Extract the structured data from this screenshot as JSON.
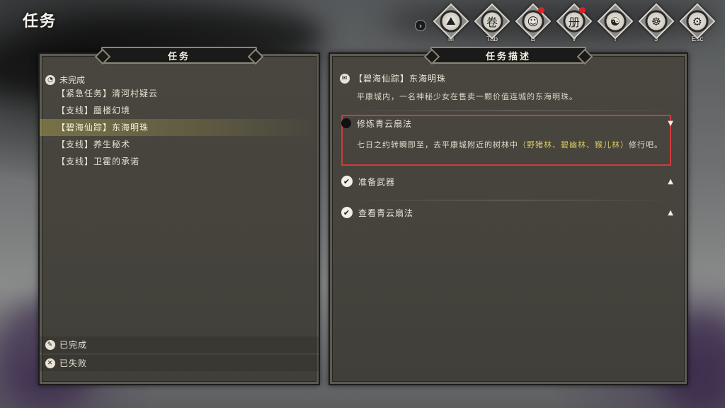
{
  "page_title": "任务",
  "toolbar": {
    "arrow": "›",
    "items": [
      {
        "key": "M",
        "icon": "map-icon",
        "glyph": "⛰",
        "badge": false
      },
      {
        "key": "Tab",
        "icon": "scroll-icon",
        "glyph": "卷",
        "badge": false
      },
      {
        "key": "B",
        "icon": "character-icon",
        "glyph": "☺",
        "badge": true
      },
      {
        "key": "V",
        "icon": "book-icon",
        "glyph": "册",
        "badge": true
      },
      {
        "key": "T",
        "icon": "skill-icon",
        "glyph": "☯",
        "badge": false
      },
      {
        "key": "J",
        "icon": "meditation-icon",
        "glyph": "☸",
        "badge": false
      },
      {
        "key": "Esc",
        "icon": "settings-icon",
        "glyph": "⚙",
        "badge": false
      }
    ]
  },
  "left_panel": {
    "header": "任务",
    "incomplete_label": "未完成",
    "quests": [
      {
        "label": "【紧急任务】清河村疑云",
        "selected": false
      },
      {
        "label": "【支线】蜃楼幻境",
        "selected": false
      },
      {
        "label": "【碧海仙踪】东海明珠",
        "selected": true
      },
      {
        "label": "【支线】养生秘术",
        "selected": false
      },
      {
        "label": "【支线】卫霍的承诺",
        "selected": false
      }
    ],
    "completed_label": "已完成",
    "failed_label": "已失败"
  },
  "right_panel": {
    "header": "任务描述",
    "quest_title": "【碧海仙踪】东海明珠",
    "quest_desc": "平康城内，一名神秘少女在售卖一颗价值连城的东海明珠。",
    "objectives": [
      {
        "label": "修炼青云扇法",
        "done": false,
        "expanded": true,
        "caret": "▼",
        "text_before": "七日之约转瞬即至，去平康城附近的树林中",
        "text_highlight": "（野猪林、碧幽林、猴儿林）",
        "text_after": "修行吧。"
      },
      {
        "label": "准备武器",
        "done": true,
        "expanded": false,
        "caret": "▲"
      },
      {
        "label": "查看青云扇法",
        "done": true,
        "expanded": false,
        "caret": "▲"
      }
    ],
    "check_glyph": "✔",
    "highlight_color": "#d23a3a"
  }
}
